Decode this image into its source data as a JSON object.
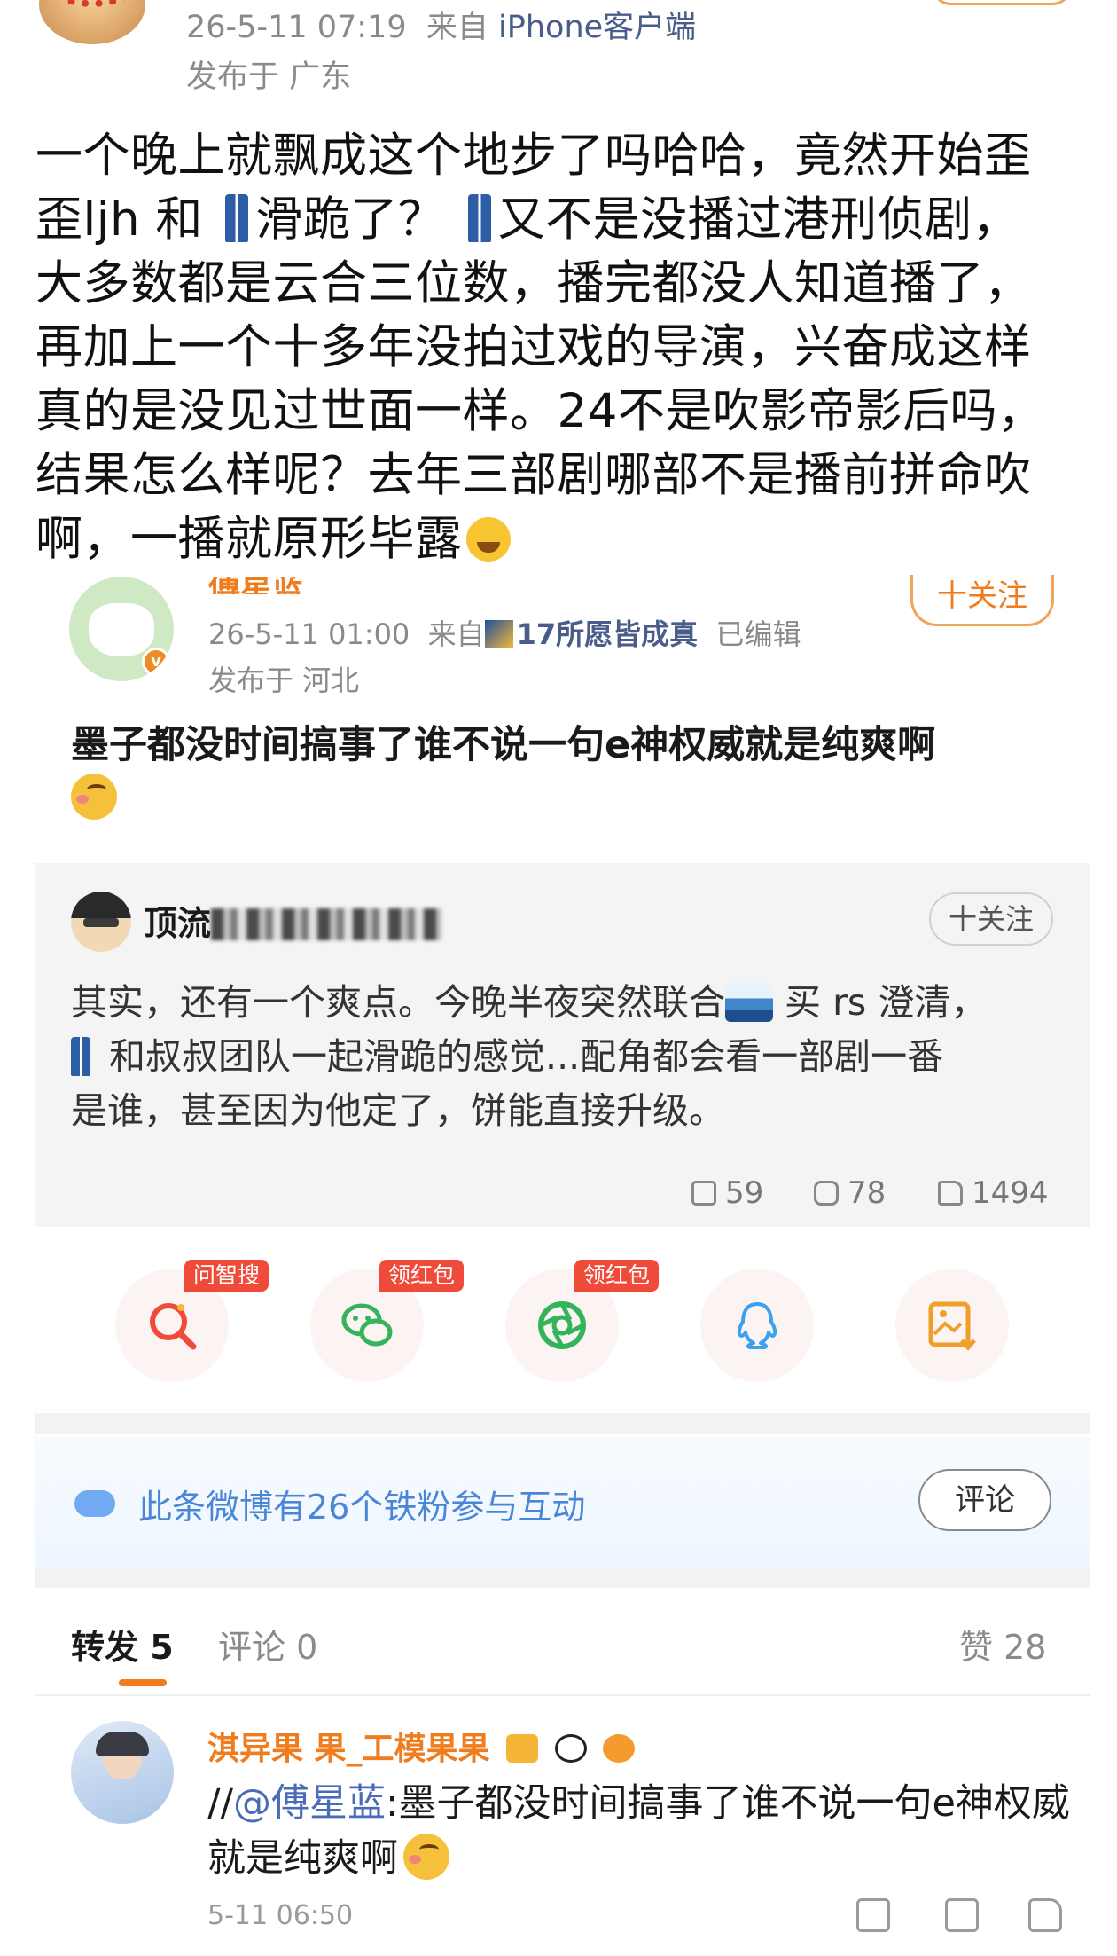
{
  "top_post": {
    "timestamp": "26-5-11 07:19",
    "source_prefix": "来自",
    "source_client": "iPhone客户端",
    "location": "发布于 广东",
    "text_lines": [
      "一个晚上就飘成这个地步了吗哈哈，竟然开始歪",
      "歪ljh 和",
      "滑跪了？",
      "又不是没播过港刑侦剧，",
      "大多数都是云合三位数，播完都没人知道播了，",
      "再加上一个十多年没拍过戏的导演，兴奋成这样",
      "真的是没见过世面一样。24不是吹影帝影后吗，",
      "结果怎么样呢？去年三部剧哪部不是播前拼命吹",
      "啊，一播就原形毕露"
    ]
  },
  "quoted_post": {
    "author_name": "傅星蓝",
    "follow_label": "十关注",
    "timestamp": "26-5-11 01:00",
    "source_prefix": "来自",
    "source_name": "17所愿皆成真",
    "edited_label": "已编辑",
    "location": "发布于 河北",
    "text": "墨子都没时间搞事了谁不说一句e神权威就是纯爽啊"
  },
  "embedded_card": {
    "author_name_visible": "顶流",
    "follow_label": "十关注",
    "text_parts": {
      "line1_a": "其实，还有一个爽点。今晚半夜突然联合",
      "line1_b": "买 rs 澄清，",
      "line2": "和叔叔团队一起滑跪的感觉...配角都会看一部剧一番",
      "line3": "是谁，甚至因为他定了，饼能直接升级。"
    },
    "stats": {
      "reposts": "59",
      "comments": "78",
      "likes": "1494"
    }
  },
  "share_row": [
    {
      "icon": "search-ai-icon",
      "tag": "问智搜",
      "color": "#f04b3a"
    },
    {
      "icon": "wechat-icon",
      "tag": "领红包",
      "color": "#35b35a"
    },
    {
      "icon": "moments-icon",
      "tag": "领红包",
      "color": "#35b35a"
    },
    {
      "icon": "qq-icon",
      "tag": "",
      "color": "#3aa0f0"
    },
    {
      "icon": "save-image-icon",
      "tag": "",
      "color": "#f0a02a"
    }
  ],
  "fans_bar": {
    "text": "此条微博有26个铁粉参与互动",
    "button_label": "评论"
  },
  "tabs": {
    "repost": "转发 5",
    "comment": "评论 0",
    "like": "赞 28"
  },
  "repost_item": {
    "author_name": "淇异果 果_工模果果",
    "text_prefix": "//",
    "mention": "@傅星蓝",
    "text_body": ":墨子都没时间搞事了谁不说一句e神权威就是纯爽啊",
    "time": "5-11 06:50"
  },
  "colors": {
    "accent": "#f07c1e",
    "link": "#4a6bb8",
    "muted": "#8a8a8a",
    "card_bg": "#f4f4f4"
  }
}
